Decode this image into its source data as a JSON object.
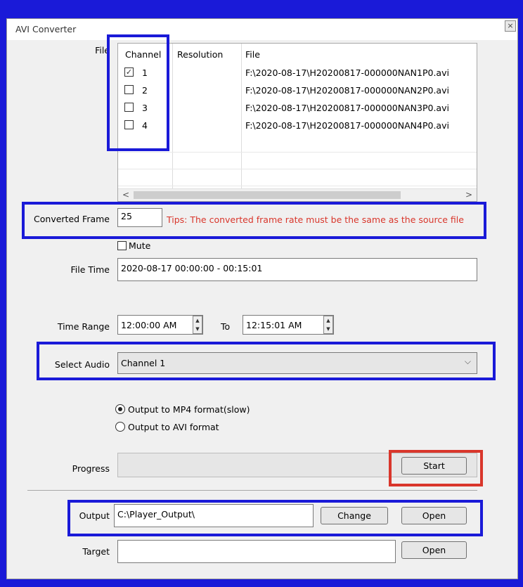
{
  "window": {
    "title": "AVI Converter",
    "close_glyph": "×"
  },
  "file_section": {
    "label": "File",
    "columns": [
      "Channel",
      "Resolution",
      "File"
    ],
    "rows": [
      {
        "checked": true,
        "channel": "1",
        "resolution": "",
        "file": "F:\\2020-08-17\\H20200817-000000NAN1P0.avi"
      },
      {
        "checked": false,
        "channel": "2",
        "resolution": "",
        "file": "F:\\2020-08-17\\H20200817-000000NAN2P0.avi"
      },
      {
        "checked": false,
        "channel": "3",
        "resolution": "",
        "file": "F:\\2020-08-17\\H20200817-000000NAN3P0.avi"
      },
      {
        "checked": false,
        "channel": "4",
        "resolution": "",
        "file": "F:\\2020-08-17\\H20200817-000000NAN4P0.avi"
      }
    ],
    "scroll_left": "<",
    "scroll_right": ">"
  },
  "converted_frame": {
    "label": "Converted Frame",
    "value": "25",
    "tip": "Tips: The converted frame rate must be the same as the source file"
  },
  "mute": {
    "label": "Mute",
    "checked": false
  },
  "file_time": {
    "label": "File Time",
    "value": "2020-08-17 00:00:00 - 00:15:01"
  },
  "time_range": {
    "label": "Time Range",
    "from": "12:00:00 AM",
    "to_label": "To",
    "to": "12:15:01 AM"
  },
  "select_audio": {
    "label": "Select Audio",
    "value": "Channel 1",
    "chevron": "⌵"
  },
  "output_format": {
    "options": [
      {
        "label": "Output to MP4 format(slow)",
        "selected": true
      },
      {
        "label": "Output to AVI format",
        "selected": false
      }
    ]
  },
  "progress": {
    "label": "Progress",
    "value": 0,
    "start_label": "Start"
  },
  "output": {
    "label": "Output",
    "value": "C:\\Player_Output\\",
    "change_label": "Change",
    "open_label": "Open"
  },
  "target": {
    "label": "Target",
    "value": "",
    "open_label": "Open"
  },
  "colors": {
    "highlight_blue": "#1a1ad8",
    "highlight_red": "#d9362b",
    "tip_red": "#d9362b"
  }
}
